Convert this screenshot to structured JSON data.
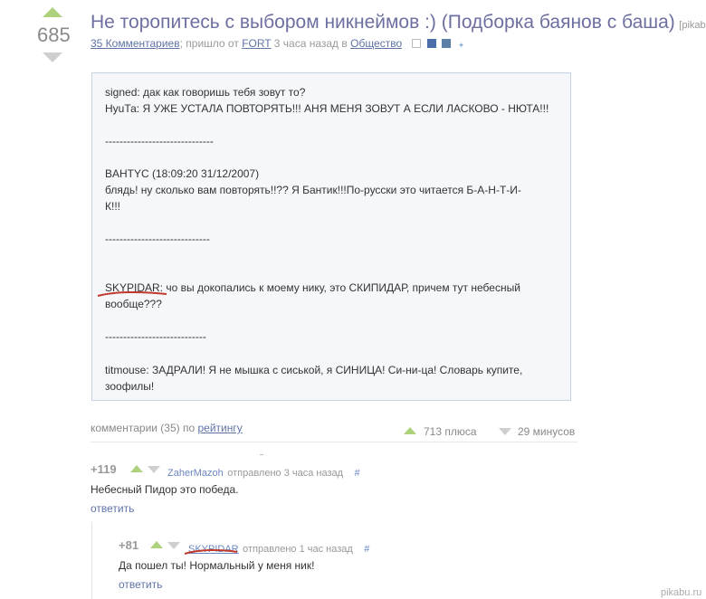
{
  "post": {
    "rating": "685",
    "title": "Не торопитесь с выбором никнеймов :) (Подборка баянов с баша)",
    "source": "[pikabu.ru]",
    "comments_link": "35 Комментариев",
    "meta_mid": "; пришло от",
    "author": "FORT",
    "meta_time": "3 часа назад в",
    "category": "Общество",
    "lines": [
      "signed: дак как говоришь тебя зовут то?",
      "НуuТа: Я УЖЕ УСТАЛА ПОВТОРЯТЬ!!! АНЯ МЕНЯ ЗОВУТ А ЕСЛИ ЛАСКОВО - НЮТА!!!",
      "------------------------------",
      "BAHTYC (18:09:20 31/12/2007)",
      "блядь! ну сколько вам повторять!!?? Я Бантик!!!По-русски это читается Б-А-Н-Т-И-",
      "К!!!",
      "-----------------------------",
      "SKYPIDAR: чо вы докопались к моему нику, это СКИПИДАР, причем тут небесный",
      "вообще???",
      "----------------------------",
      "titmouse: ЗАДРАЛИ! Я не мышка с сиськой, я СИНИЦА! Си-ни-ца! Словарь купите,",
      "зоофилы!"
    ]
  },
  "comments_bar": {
    "label": "комментарии (35) по",
    "sort": "рейтингу",
    "pluses": "713 плюса",
    "minuses": "29 минусов"
  },
  "comments": [
    {
      "score": "+119",
      "author": "ZaherMazoh",
      "meta": "отправлено 3 часа назад",
      "hash": "#",
      "text": "Небесный Пидор это победа.",
      "reply": "ответить"
    },
    {
      "score": "+81",
      "author": "SKYPIDAR",
      "meta": "отправлено 1 час назад",
      "hash": "#",
      "text": "Да пошел ты! Нормальный у меня ник!",
      "reply": "ответить"
    }
  ],
  "watermark": "pikabu.ru",
  "colors": {
    "title": "#6c6fa0",
    "upvote": "#aed27c",
    "downvote": "#cfcfcf",
    "underline_mark": "#c0392b"
  }
}
